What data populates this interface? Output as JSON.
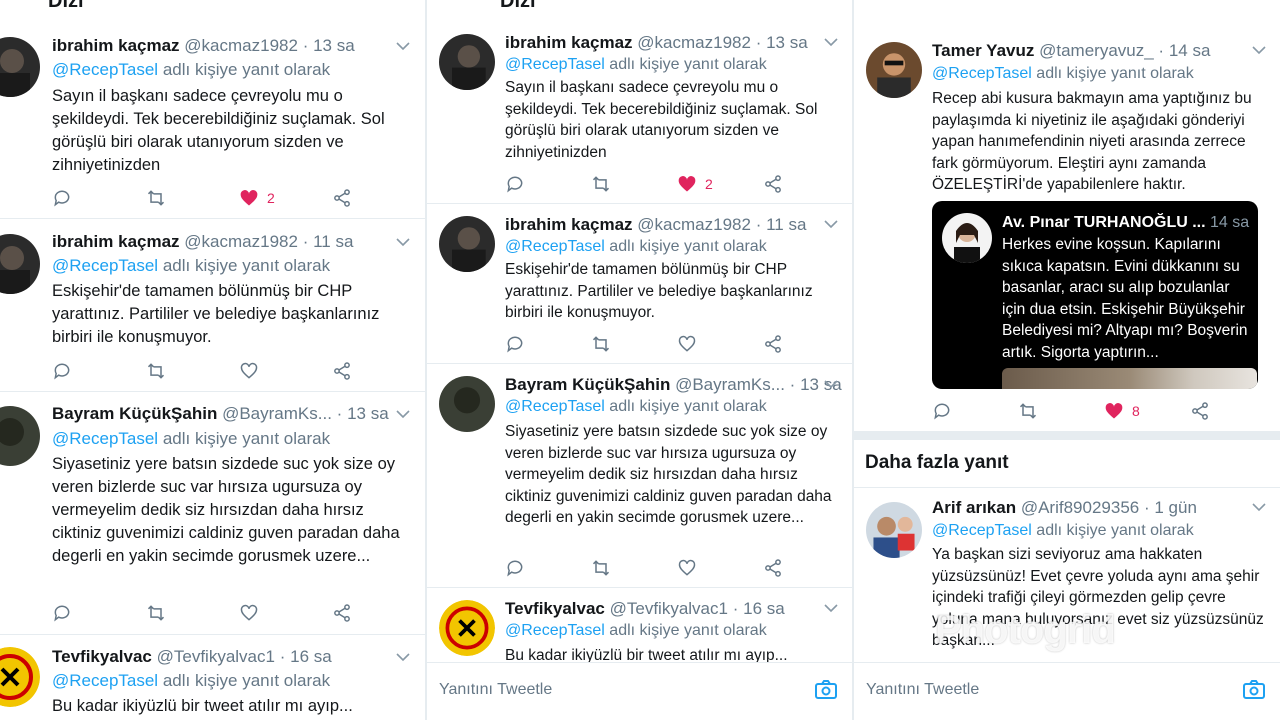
{
  "colors": {
    "accent": "#1da1f2",
    "like": "#e0245e",
    "muted": "#657786",
    "divider": "#e6ecf0"
  },
  "panel1": {
    "top_cut_text": "Dizi",
    "tweets": [
      {
        "name": "ibrahim kaçmaz",
        "handle": "@kacmaz1982",
        "dot": "·",
        "time": "13 sa",
        "reply_prefix": "@RecepTasel",
        "reply_suffix": "adlı kişiye yanıt olarak",
        "text": "Sayın il başkanı sadece çevreyolu mu o şekildeydi. Tek becerebildiğiniz suçlamak. Sol görüşlü biri olarak utanıyorum sizden ve zihniyetinizden",
        "likes": "2",
        "liked": true
      },
      {
        "name": "ibrahim kaçmaz",
        "handle": "@kacmaz1982",
        "dot": "·",
        "time": "11 sa",
        "reply_prefix": "@RecepTasel",
        "reply_suffix": "adlı kişiye yanıt olarak",
        "text": "Eskişehir'de tamamen bölünmüş bir CHP yarattınız. Partililer ve belediye başkanlarınız birbiri ile konuşmuyor.",
        "likes": "",
        "liked": false
      },
      {
        "name": "Bayram KüçükŞahin",
        "handle": "@BayramKs...",
        "dot": "·",
        "time": "13 sa",
        "reply_prefix": "@RecepTasel",
        "reply_suffix": "adlı kişiye yanıt olarak",
        "text": "Siyasetiniz yere batsın sizdede suc yok size oy veren bizlerde suc var hırsıza ugursuza oy vermeyelim dedik siz hırsızdan daha hırsız ciktiniz guvenimizi caldiniz guven paradan daha degerli en yakin secimde gorusmek uzere...",
        "likes": "",
        "liked": false
      },
      {
        "name": "Tevfikyalvac",
        "handle": "@Tevfikyalvac1",
        "dot": "·",
        "time": "16 sa",
        "reply_prefix": "@RecepTasel",
        "reply_suffix": "adlı kişiye yanıt olarak",
        "text": "Bu kadar ikiyüzlü bir tweet atılır mı ayıp...",
        "likes": "",
        "liked": false
      }
    ]
  },
  "panel2": {
    "top_cut_text": "Dizi",
    "tweets": [
      {
        "name": "ibrahim kaçmaz",
        "handle": "@kacmaz1982",
        "dot": "·",
        "time": "13 sa",
        "reply_prefix": "@RecepTasel",
        "reply_suffix": "adlı kişiye yanıt olarak",
        "text": "Sayın il başkanı sadece çevreyolu mu o şekildeydi. Tek becerebildiğiniz suçlamak. Sol görüşlü biri olarak utanıyorum sizden ve zihniyetinizden",
        "likes": "2",
        "liked": true
      },
      {
        "name": "ibrahim kaçmaz",
        "handle": "@kacmaz1982",
        "dot": "·",
        "time": "11 sa",
        "reply_prefix": "@RecepTasel",
        "reply_suffix": "adlı kişiye yanıt olarak",
        "text": "Eskişehir'de tamamen bölünmüş bir CHP yarattınız. Partililer ve belediye başkanlarınız birbiri ile konuşmuyor.",
        "likes": "",
        "liked": false
      },
      {
        "name": "Bayram KüçükŞahin",
        "handle": "@BayramKs...",
        "dot": "·",
        "time": "13 sa",
        "reply_prefix": "@RecepTasel",
        "reply_suffix": "adlı kişiye yanıt olarak",
        "text": "Siyasetiniz yere batsın sizdede suc yok size oy veren bizlerde suc var hırsıza ugursuza oy vermeyelim dedik siz hırsızdan daha hırsız ciktiniz guvenimizi caldiniz guven paradan daha degerli en yakin secimde gorusmek uzere...",
        "likes": "",
        "liked": false
      },
      {
        "name": "Tevfikyalvac",
        "handle": "@Tevfikyalvac1",
        "dot": "·",
        "time": "16 sa",
        "reply_prefix": "@RecepTasel",
        "reply_suffix": "adlı kişiye yanıt olarak",
        "text": "Bu kadar ikiyüzlü bir tweet atılır mı ayıp...",
        "likes": "",
        "liked": false
      }
    ],
    "composer_placeholder": "Yanıtını Tweetle"
  },
  "panel3": {
    "tweet": {
      "name": "Tamer Yavuz",
      "handle": "@tameryavuz_",
      "dot": "·",
      "time": "14 sa",
      "reply_prefix": "@RecepTasel",
      "reply_suffix": "adlı kişiye yanıt olarak",
      "text": "Recep abi kusura bakmayın ama yaptığınız bu paylaşımda ki niyetiniz ile aşağıdaki gönderiyi yapan hanımefendinin niyeti arasında zerrece fark görmüyorum. Eleştiri aynı zamanda ÖZELEŞTİRİ'de yapabilenlere haktır.",
      "likes": "8",
      "liked": true,
      "quote": {
        "name": "Av. Pınar TURHANOĞLU ...",
        "time": "14 sa",
        "text": "Herkes evine koşsun. Kapılarını sıkıca kapatsın. Evini dükkanını su basanlar, aracı su alıp bozulanlar için dua etsin. Eskişehir Büyükşehir Belediyesi mi? Altyapı mı? Boşverin artık. Sigorta yaptırın..."
      }
    },
    "more_replies_title": "Daha fazla yanıt",
    "reply": {
      "name": "Arif arıkan",
      "handle": "@Arif89029356",
      "dot": "·",
      "time": "1 gün",
      "reply_prefix": "@RecepTasel",
      "reply_suffix": "adlı kişiye yanıt olarak",
      "text": "Ya başkan sizi seviyoruz ama hakkaten yüzsüzsünüz! Evet çevre yoluda aynı ama şehir içindeki trafiği çileyi görmezden gelip çevre yoluna mana buluyorsanız evet siz yüzsüzsünüz başkan..."
    },
    "composer_placeholder": "Yanıtını Tweetle",
    "watermark": "Photogrid"
  }
}
